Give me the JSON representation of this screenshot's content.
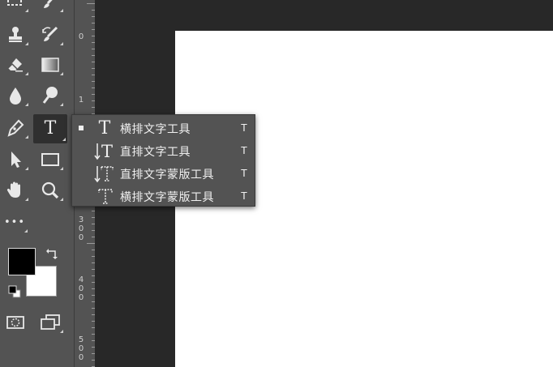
{
  "toolbar": {
    "tools": [
      {
        "name": "marquee-tool-icon"
      },
      {
        "name": "brush-tool-icon"
      },
      {
        "name": "clone-stamp-tool-icon"
      },
      {
        "name": "history-brush-tool-icon"
      },
      {
        "name": "eraser-tool-icon"
      },
      {
        "name": "gradient-tool-icon"
      },
      {
        "name": "blur-tool-icon"
      },
      {
        "name": "dodge-tool-icon"
      },
      {
        "name": "pen-tool-icon"
      },
      {
        "name": "type-tool-icon",
        "glyph": "T",
        "active": true
      },
      {
        "name": "path-selection-tool-icon"
      },
      {
        "name": "rectangle-tool-icon"
      },
      {
        "name": "hand-tool-icon"
      },
      {
        "name": "zoom-tool-icon"
      },
      {
        "name": "more-tools-icon",
        "glyph": "•••"
      }
    ],
    "foreground_color": "#000000",
    "background_color": "#ffffff"
  },
  "ruler": {
    "labels": [
      "0",
      "1",
      "3\n0\n0",
      "4\n0\n0",
      "5\n0\n0"
    ]
  },
  "flyout": {
    "items": [
      {
        "icon": "horizontal-type-icon",
        "label": "横排文字工具",
        "shortcut": "T",
        "selected": true
      },
      {
        "icon": "vertical-type-icon",
        "label": "直排文字工具",
        "shortcut": "T",
        "selected": false
      },
      {
        "icon": "vertical-type-mask-icon",
        "label": "直排文字蒙版工具",
        "shortcut": "T",
        "selected": false
      },
      {
        "icon": "horizontal-type-mask-icon",
        "label": "横排文字蒙版工具",
        "shortcut": "T",
        "selected": false
      }
    ]
  },
  "colors": {
    "toolbar_bg": "#535353",
    "workspace_bg": "#282828",
    "canvas_bg": "#ffffff",
    "active_tool_bg": "#2f2f2f"
  }
}
